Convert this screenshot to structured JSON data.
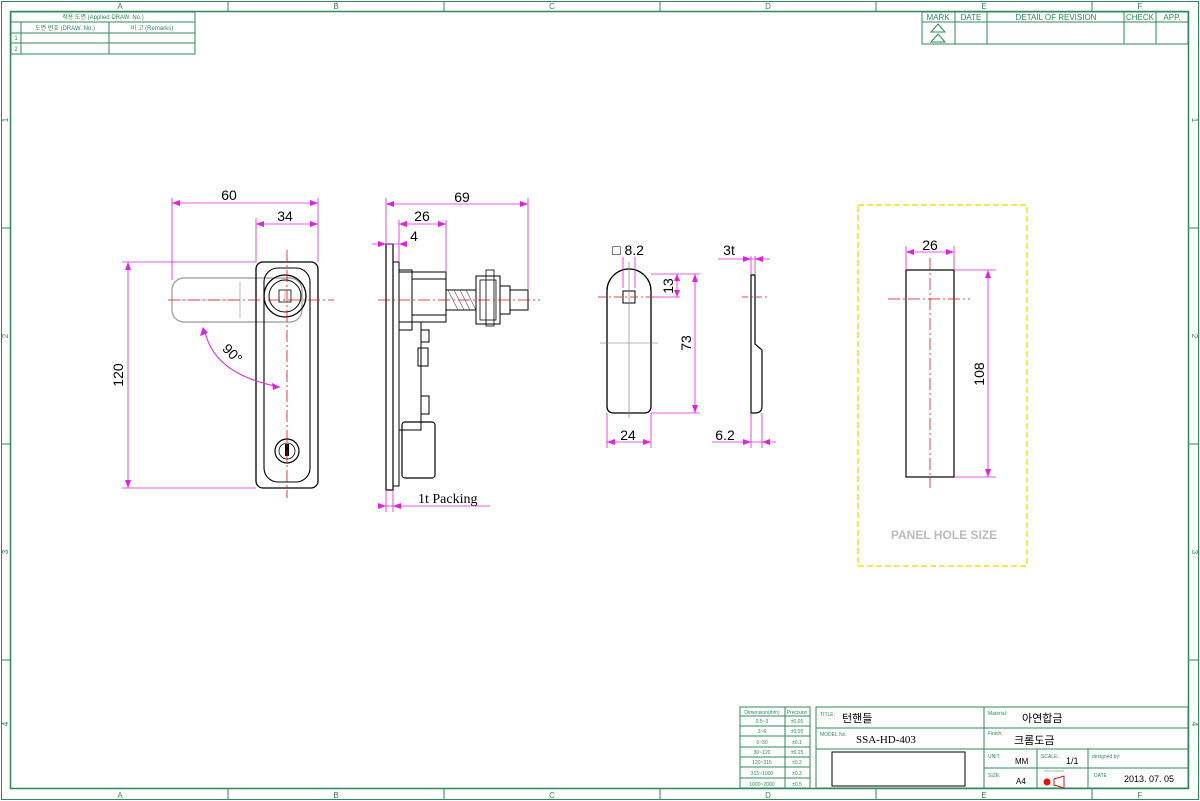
{
  "border": {
    "columns": [
      "A",
      "B",
      "C",
      "D",
      "E",
      "F"
    ],
    "rows": [
      "1",
      "2",
      "3",
      "4"
    ]
  },
  "applied_table": {
    "header": "적용 도면 (Applied DRAW. No.)",
    "col1": "도면 번호 (DRAW. No.)",
    "col2": "비 고 (Remarks)",
    "rows": [
      "1",
      "2"
    ]
  },
  "revision_table": {
    "headers": [
      "MARK",
      "DATE",
      "DETAIL OF REVISION",
      "CHECK",
      "APP."
    ]
  },
  "dimensions": {
    "front_width": "60",
    "front_handle_width": "34",
    "front_height": "120",
    "rotation": "90°",
    "side_depth": "69",
    "side_mid": "26",
    "side_small": "4",
    "packing": "1t Packing",
    "cam_square": "□ 8.2",
    "cam_offset": "13",
    "cam_length": "73",
    "cam_width": "24",
    "cam_thickness": "3t",
    "cam_side": "6.2",
    "panel_width": "26",
    "panel_height": "108"
  },
  "panel_label": "PANEL HOLE SIZE",
  "tolerance_table": {
    "headers": [
      "Dimension(mm)",
      "Precision"
    ],
    "rows": [
      [
        "0.5~3",
        "±0.05"
      ],
      [
        "3~6",
        "±0.05"
      ],
      [
        "6~30",
        "±0.1"
      ],
      [
        "30~120",
        "±0.15"
      ],
      [
        "120~315",
        "±0.2"
      ],
      [
        "315~1000",
        "±0.3"
      ],
      [
        "1000~2000",
        "±0.5"
      ]
    ]
  },
  "title_block": {
    "title_label": "TITLE:",
    "title": "턴핸들",
    "model_label": "MODEL No.",
    "model": "SSA-HD-403",
    "material_label": "Material:",
    "material": "아연합금",
    "finish_label": "Finish:",
    "finish": "크롬도금",
    "unit_label": "UNIT:",
    "unit": "MM",
    "scale_label": "SCALE:",
    "scale": "1/1",
    "designed_label": "designed by:",
    "size_label": "SIZE:",
    "size": "A4",
    "date_label": "DATE :",
    "date": "2013. 07. 05"
  },
  "colors": {
    "frame": "#2e8b57",
    "dimension": "#e020e0",
    "centerline": "#e01010",
    "panel_outline": "#f0e020"
  }
}
